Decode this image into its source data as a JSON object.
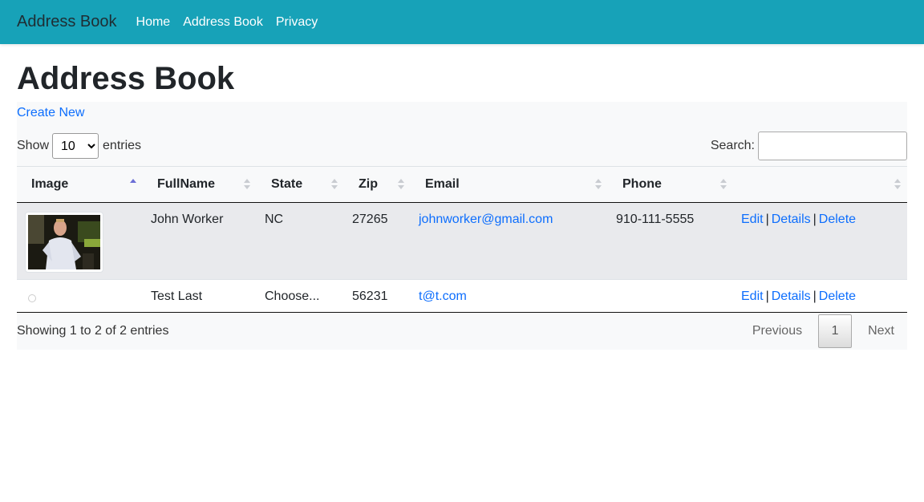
{
  "navbar": {
    "brand": "Address Book",
    "links": [
      "Home",
      "Address Book",
      "Privacy"
    ],
    "color": "#17a2b8"
  },
  "page": {
    "title": "Address Book",
    "create_link": "Create New"
  },
  "controls": {
    "show_label": "Show",
    "entries_label": "entries",
    "page_length": "10",
    "search_label": "Search:",
    "search_value": ""
  },
  "table": {
    "columns": [
      "Image",
      "FullName",
      "State",
      "Zip",
      "Email",
      "Phone",
      ""
    ],
    "sorted_column": "Image",
    "rows": [
      {
        "has_image": true,
        "fullname": "John Worker",
        "state": "NC",
        "zip": "27265",
        "email": "johnworker@gmail.com",
        "phone": "910-111-5555",
        "actions": [
          "Edit",
          "Details",
          "Delete"
        ]
      },
      {
        "has_image": false,
        "fullname": "Test Last",
        "state": "Choose...",
        "zip": "56231",
        "email": "t@t.com",
        "phone": "",
        "actions": [
          "Edit",
          "Details",
          "Delete"
        ]
      }
    ],
    "action_separator": "|"
  },
  "footer": {
    "info": "Showing 1 to 2 of 2 entries",
    "previous": "Previous",
    "current_page": "1",
    "next": "Next"
  },
  "colors": {
    "link": "#0d6efd",
    "stripe": "#e9eaed",
    "panel": "#f8f9fa"
  }
}
